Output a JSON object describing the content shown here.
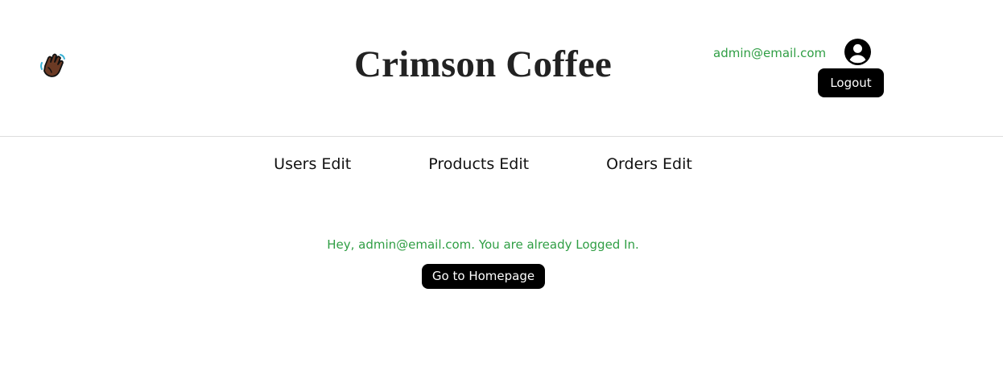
{
  "header": {
    "brand": "Crimson Coffee",
    "wave_icon": "waving-hand-icon",
    "user_email": "admin@email.com",
    "account_icon": "account-circle-icon",
    "logout_label": "Logout"
  },
  "nav": {
    "items": [
      {
        "label": "Users Edit"
      },
      {
        "label": "Products Edit"
      },
      {
        "label": "Orders Edit"
      }
    ]
  },
  "main": {
    "notice": "Hey, admin@email.com. You are already Logged In.",
    "home_button_label": "Go to Homepage"
  },
  "colors": {
    "accent_green": "#2f9e44",
    "button_bg": "#000000",
    "button_text": "#ffffff",
    "divider": "#dcdcdc"
  }
}
